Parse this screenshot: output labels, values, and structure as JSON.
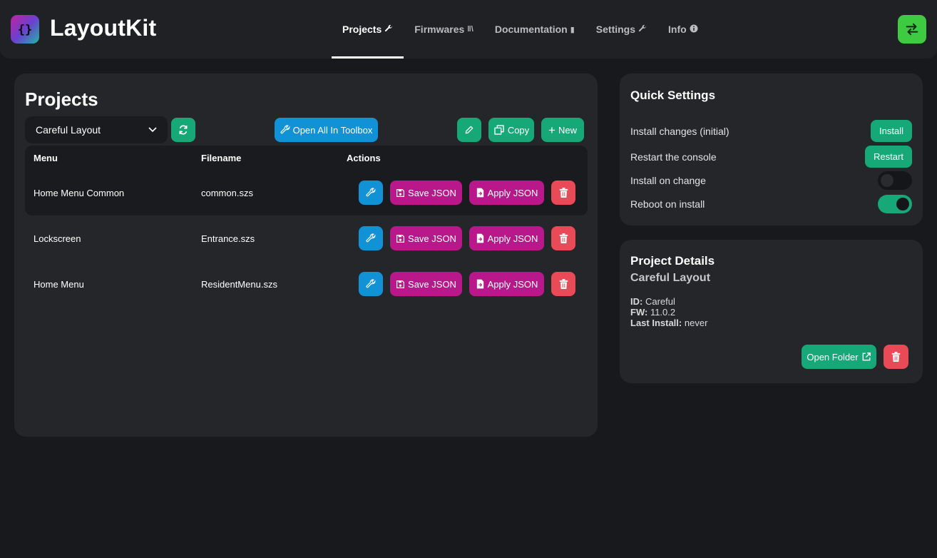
{
  "app": {
    "title": "LayoutKit"
  },
  "nav": {
    "items": [
      {
        "label": "Projects",
        "icon": "wrench-icon",
        "glyph": "🔧"
      },
      {
        "label": "Firmwares",
        "icon": "books-icon",
        "glyph": "‖\\"
      },
      {
        "label": "Documentation",
        "icon": "book-icon",
        "glyph": "▮"
      },
      {
        "label": "Settings",
        "icon": "wrench-icon",
        "glyph": "🔧"
      },
      {
        "label": "Info",
        "icon": "info-icon",
        "glyph": "ⓘ"
      }
    ],
    "active": "Projects"
  },
  "projects": {
    "title": "Projects",
    "selected_project": "Careful Layout",
    "open_all_label": "Open All In Toolbox",
    "copy_label": "Copy",
    "new_label": "New",
    "columns": [
      "Menu",
      "Filename",
      "Actions"
    ],
    "save_label": "Save JSON",
    "apply_label": "Apply JSON",
    "rows": [
      {
        "menu": "Home Menu Common",
        "filename": "common.szs"
      },
      {
        "menu": "Lockscreen",
        "filename": "Entrance.szs"
      },
      {
        "menu": "Home Menu",
        "filename": "ResidentMenu.szs"
      }
    ]
  },
  "quick_settings": {
    "title": "Quick Settings",
    "install_changes_label": "Install changes (initial)",
    "install_button": "Install",
    "restart_console_label": "Restart the console",
    "restart_button": "Restart",
    "install_on_change_label": "Install on change",
    "install_on_change": false,
    "reboot_on_install_label": "Reboot on install",
    "reboot_on_install": true
  },
  "project_details": {
    "title": "Project Details",
    "name": "Careful Layout",
    "id_label": "ID:",
    "id": "Careful",
    "fw_label": "FW:",
    "fw": "11.0.2",
    "last_install_label": "Last Install:",
    "last_install": "never",
    "open_folder_label": "Open Folder"
  },
  "colors": {
    "accent_green": "#17a878",
    "accent_blue": "#1191d6",
    "accent_magenta": "#b8188a",
    "danger_red": "#e94a57",
    "sync_green": "#3ecb42"
  }
}
